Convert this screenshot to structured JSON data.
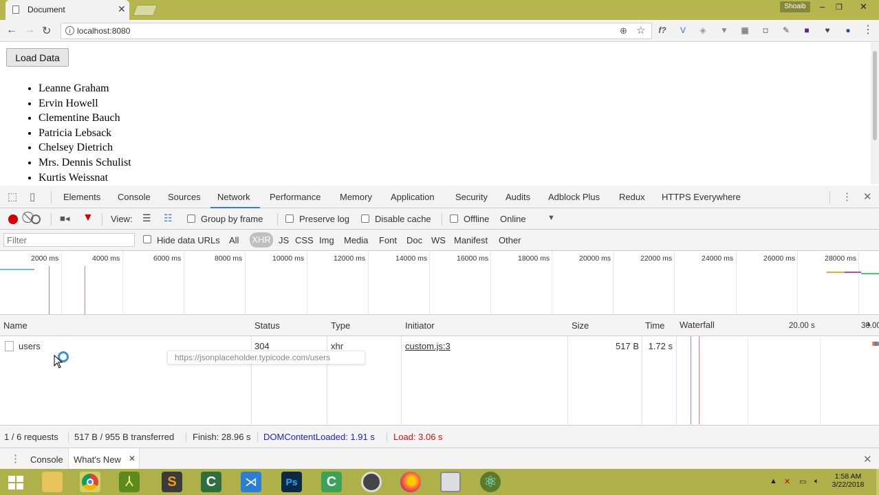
{
  "browser": {
    "tab_title": "Document",
    "user_name": "Shoaib",
    "url": "localhost:8080"
  },
  "page": {
    "load_button": "Load Data",
    "users": [
      "Leanne Graham",
      "Ervin Howell",
      "Clementine Bauch",
      "Patricia Lebsack",
      "Chelsey Dietrich",
      "Mrs. Dennis Schulist",
      "Kurtis Weissnat"
    ]
  },
  "devtools": {
    "tabs": [
      "Elements",
      "Console",
      "Sources",
      "Network",
      "Performance",
      "Memory",
      "Application",
      "Security",
      "Audits",
      "Adblock Plus",
      "Redux",
      "HTTPS Everywhere"
    ],
    "selected_tab": "Network",
    "toolbar": {
      "view_label": "View:",
      "group_by_frame": "Group by frame",
      "preserve_log": "Preserve log",
      "disable_cache": "Disable cache",
      "offline": "Offline",
      "throttle": "Online"
    },
    "filter": {
      "placeholder": "Filter",
      "hide_data_urls": "Hide data URLs",
      "types": [
        "All",
        "XHR",
        "JS",
        "CSS",
        "Img",
        "Media",
        "Font",
        "Doc",
        "WS",
        "Manifest",
        "Other"
      ],
      "selected_type": "XHR"
    },
    "overview_ticks": [
      "2000 ms",
      "4000 ms",
      "6000 ms",
      "8000 ms",
      "10000 ms",
      "12000 ms",
      "14000 ms",
      "16000 ms",
      "18000 ms",
      "20000 ms",
      "22000 ms",
      "24000 ms",
      "26000 ms",
      "28000 ms"
    ],
    "columns": {
      "name": "Name",
      "status": "Status",
      "type": "Type",
      "initiator": "Initiator",
      "size": "Size",
      "time": "Time",
      "waterfall": "Waterfall",
      "wf_tick1": "20.00 s",
      "wf_tick2": "30.00"
    },
    "request": {
      "name": "users",
      "status": "304",
      "type": "xhr",
      "initiator": "custom.js:3",
      "size": "517 B",
      "time": "1.72 s",
      "tooltip": "https://jsonplaceholder.typicode.com/users"
    },
    "summary": {
      "requests": "1 / 6 requests",
      "transferred": "517 B / 955 B transferred",
      "finish": "Finish: 28.96 s",
      "dom_content_loaded": "DOMContentLoaded: 1.91 s",
      "load": "Load: 3.06 s",
      "dcl_color": "#2222cc",
      "load_color": "#d11111"
    },
    "drawer": {
      "console_tab": "Console",
      "whats_new_tab": "What's New"
    }
  },
  "taskbar": {
    "time": "1:58 AM",
    "date": "3/22/2018"
  }
}
